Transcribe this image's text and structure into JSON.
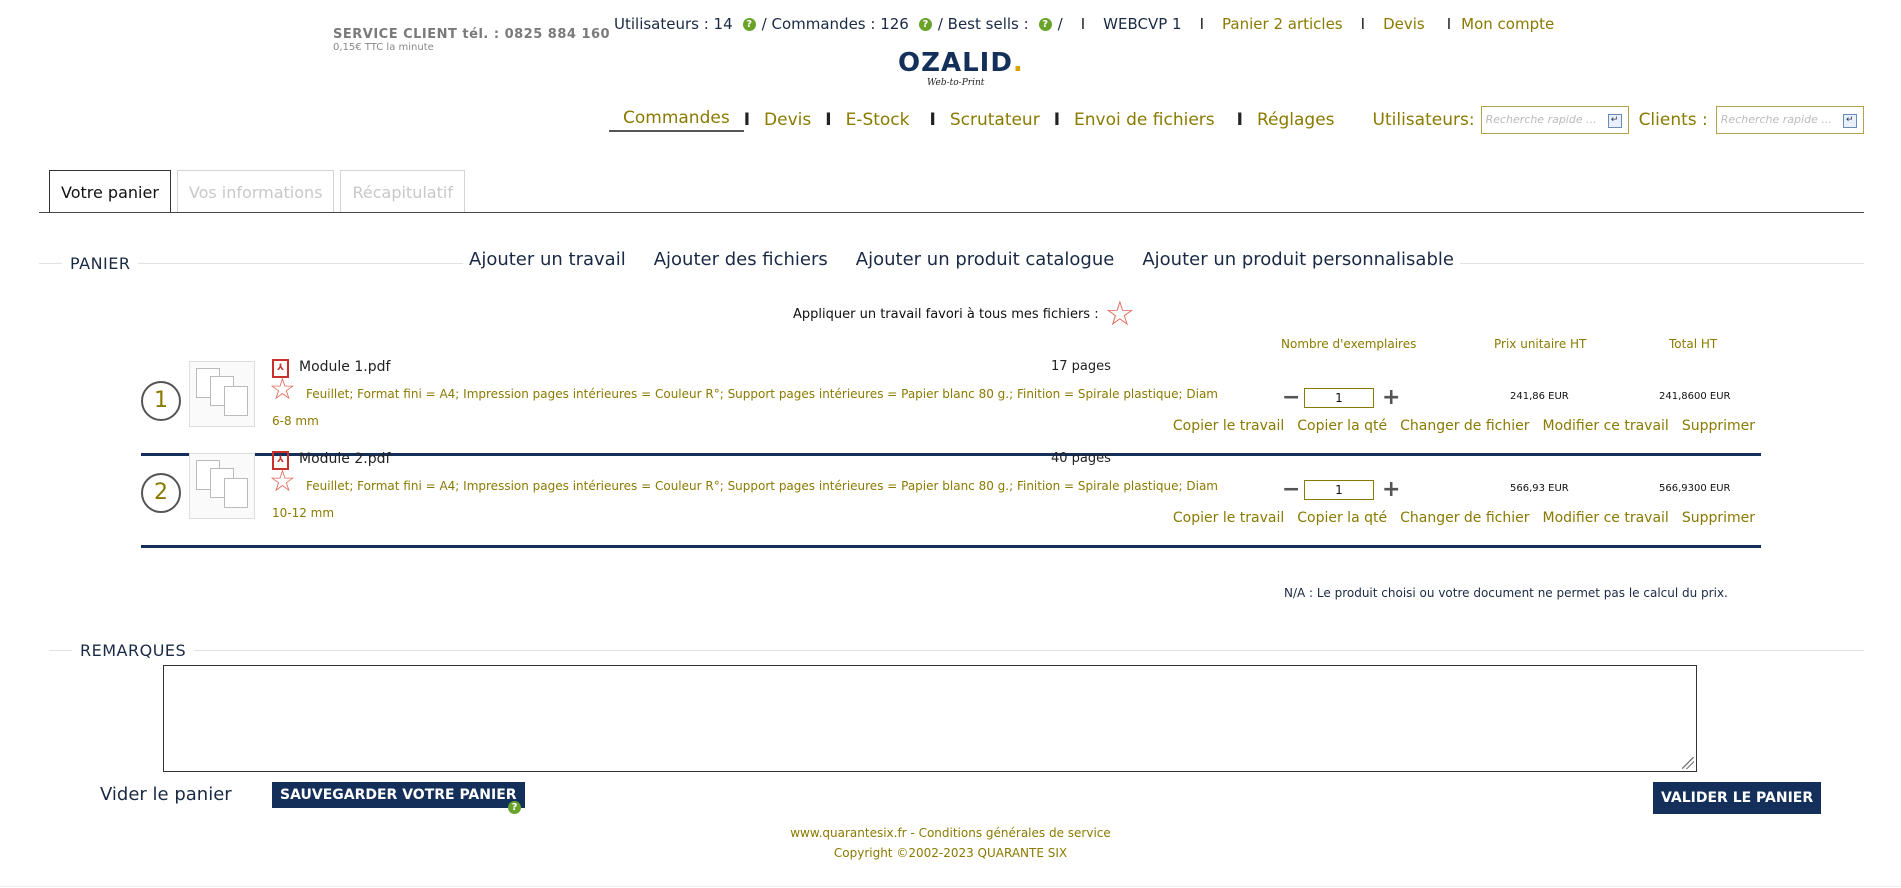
{
  "service": {
    "line1": "SERVICE CLIENT tél. :  0825 884 160",
    "line2": "0,15€ TTC la minute"
  },
  "topbar": {
    "users": "Utilisateurs : 14",
    "orders": "/ Commandes : 126",
    "bestsells": "/ Best sells :",
    "bestsells_tail": "/",
    "help_glyph": "?",
    "separator": "I",
    "account_code": "WEBCVP 1",
    "cart": "Panier 2 articles",
    "quotes": "Devis",
    "my_account": "Mon compte"
  },
  "logo": {
    "name": "OZALID",
    "dot": ".",
    "tagline": "Web-to-Print"
  },
  "nav": {
    "items": [
      "Commandes",
      "Devis",
      "E-Stock",
      "Scrutateur",
      "Envoi de fichiers",
      "Réglages"
    ],
    "separator": "I",
    "users_label": "Utilisateurs:",
    "users_placeholder": "Recherche rapide ...",
    "clients_label": "Clients :",
    "clients_placeholder": "Recherche rapide ...",
    "enter_glyph": "↵"
  },
  "tabs": [
    "Votre panier",
    "Vos informations",
    "Récapitulatif"
  ],
  "panier": {
    "title": "PANIER",
    "actions": [
      "Ajouter un travail",
      "Ajouter des fichiers",
      "Ajouter un produit catalogue",
      "Ajouter un produit personnalisable"
    ],
    "favorite_text": "Appliquer un travail favori à tous mes fichiers :",
    "star_glyph": "☆",
    "columns": {
      "qty": "Nombre d'exemplaires",
      "unit": "Prix unitaire HT",
      "total": "Total HT"
    },
    "minus": "−",
    "plus": "+",
    "items": [
      {
        "num": "1",
        "pdf_glyph": "⅄",
        "file": "Module 1.pdf",
        "pages": "17 pages",
        "desc": "Feuillet; Format fini = A4; Impression pages intérieures = Couleur R°; Support pages intérieures = Papier blanc 80 g.; Finition = Spirale plastique; Diam 6-8 mm",
        "qty": "1",
        "unit_price": "241,86 EUR",
        "total": "241,8600 EUR",
        "actions": [
          "Copier le travail",
          "Copier la qté",
          "Changer de fichier",
          "Modifier ce travail",
          "Supprimer"
        ]
      },
      {
        "num": "2",
        "pdf_glyph": "⅄",
        "file": "Module 2.pdf",
        "pages": "40 pages",
        "desc": "Feuillet; Format fini = A4; Impression pages intérieures = Couleur R°; Support pages intérieures = Papier blanc 80 g.; Finition = Spirale plastique; Diam 10-12 mm",
        "qty": "1",
        "unit_price": "566,93 EUR",
        "total": "566,9300 EUR",
        "actions": [
          "Copier le travail",
          "Copier la qté",
          "Changer de fichier",
          "Modifier ce travail",
          "Supprimer"
        ]
      }
    ],
    "na_note": "N/A : Le produit choisi ou votre document ne permet pas le calcul du prix."
  },
  "remarques": {
    "title": "REMARQUES",
    "value": ""
  },
  "footer_actions": {
    "empty": "Vider le panier",
    "save": "SAUVEGARDER VOTRE PANIER",
    "validate": "VALIDER LE PANIER"
  },
  "footer": {
    "links": "www.quarantesix.fr - Conditions générales de service",
    "copyright": "Copyright ©2002-2023  QUARANTE SIX"
  },
  "colors": {
    "olive": "#8a7a00",
    "navy": "#14305a",
    "star": "#e06a5a",
    "help": "#6aa32a"
  }
}
